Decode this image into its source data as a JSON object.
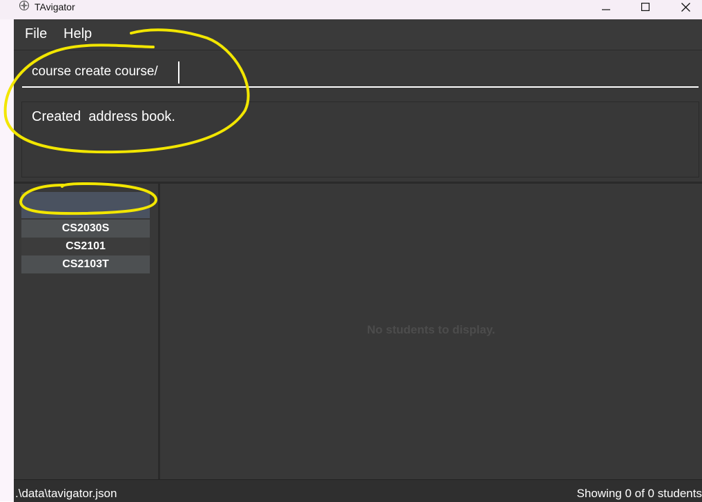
{
  "window": {
    "title": "TAvigator"
  },
  "menu": {
    "file_label": "File",
    "help_label": "Help"
  },
  "command": {
    "value": "course create course/"
  },
  "result": {
    "text": "Created  address book."
  },
  "courses": {
    "items": [
      {
        "label": "",
        "selected": true
      },
      {
        "label": "CS2030S",
        "selected": false
      },
      {
        "label": "CS2101",
        "selected": false
      },
      {
        "label": "CS2103T",
        "selected": false
      }
    ]
  },
  "students": {
    "empty_message": "No students to display."
  },
  "status": {
    "file_path": ".\\data\\tavigator.json",
    "count_text": "Showing 0 of 0 students"
  },
  "colors": {
    "background": "#383838",
    "selected_course": "#4a5260",
    "course_stripe": "#4d5052",
    "course_alt": "#3c3c3c",
    "highlight": "#f2e600"
  },
  "icons": {
    "app": "compass-icon",
    "minimize": "minimize-icon",
    "maximize": "maximize-icon",
    "close": "close-icon"
  }
}
